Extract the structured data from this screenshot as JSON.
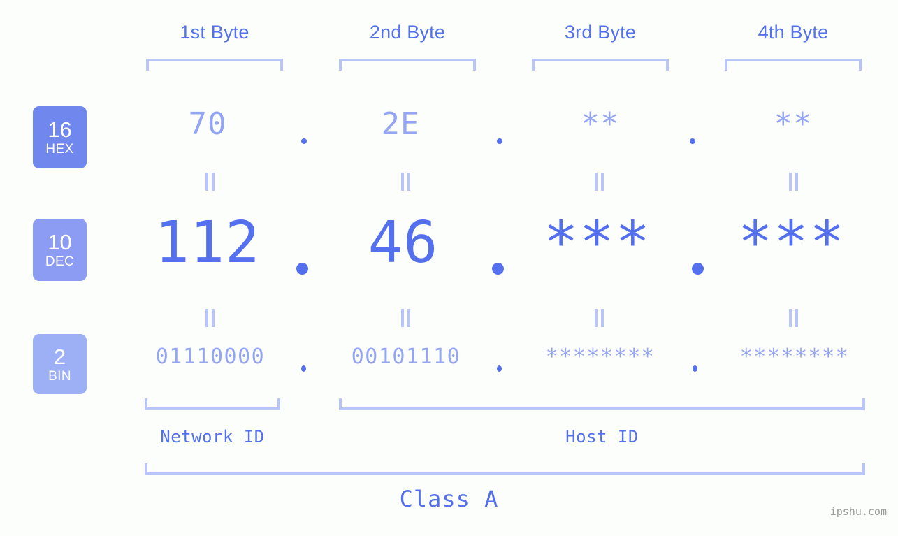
{
  "theme": {
    "background": "#fcfefb",
    "accent_strong": "#5470ee",
    "accent_mid": "#93a5f4",
    "accent_light": "#b9c4fb",
    "badge_hex_bg": "#7087ee",
    "badge_dec_bg": "#8b9cf2",
    "badge_bin_bg": "#9db0f6",
    "watermark_color": "#9a9a9a"
  },
  "columns": [
    {
      "header": "1st Byte"
    },
    {
      "header": "2nd Byte"
    },
    {
      "header": "3rd Byte"
    },
    {
      "header": "4th Byte"
    }
  ],
  "rows": [
    {
      "base": "16",
      "system": "HEX",
      "values": [
        "70",
        "2E",
        "**",
        "**"
      ]
    },
    {
      "base": "10",
      "system": "DEC",
      "values": [
        "112",
        "46",
        "***",
        "***"
      ]
    },
    {
      "base": "2",
      "system": "BIN",
      "values": [
        "01110000",
        "00101110",
        "********",
        "********"
      ]
    }
  ],
  "separators": {
    "dot": ".",
    "equals": "="
  },
  "segments": {
    "network_id_label": "Network ID",
    "host_id_label": "Host ID"
  },
  "class_label": "Class A",
  "watermark": "ipshu.com"
}
